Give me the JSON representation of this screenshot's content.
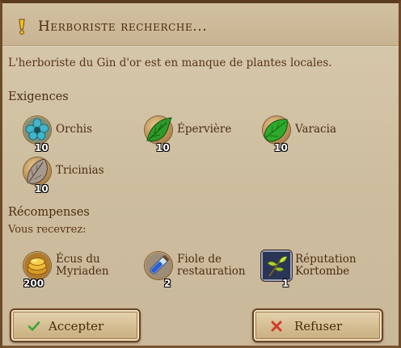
{
  "window": {
    "title": "Herboriste recherche...",
    "title_icon": "exclamation-icon",
    "description": "L'herboriste du Gin d'or est en manque de plantes locales."
  },
  "requirements": {
    "heading": "Exigences",
    "items": [
      {
        "name": "Orchis",
        "quantity": "10",
        "icon": "orchis-flower-icon"
      },
      {
        "name": "Épervière",
        "quantity": "10",
        "icon": "epervière-leaf-icon"
      },
      {
        "name": "Varacia",
        "quantity": "10",
        "icon": "varacia-leaf-icon"
      },
      {
        "name": "Tricinias",
        "quantity": "10",
        "icon": "tricinias-leaf-icon"
      }
    ]
  },
  "rewards": {
    "heading": "Récompenses",
    "subheading": "Vous recevrez:",
    "items": [
      {
        "line1": "Écus du",
        "line2": "Myriaden",
        "quantity": "200",
        "icon": "coin-pile-icon"
      },
      {
        "line1": "Fiole de",
        "line2": "restauration",
        "quantity": "2",
        "icon": "potion-vial-icon"
      },
      {
        "line1": "Réputation",
        "line2": "Kortombe",
        "quantity": "1",
        "icon": "reputation-plant-icon"
      }
    ]
  },
  "buttons": {
    "accept": {
      "label": "Accepter",
      "icon": "checkmark-icon",
      "icon_color": "#3aa832"
    },
    "refuse": {
      "label": "Refuser",
      "icon": "cross-icon",
      "icon_color": "#d23a2a"
    }
  },
  "colors": {
    "panel_background": "#cdbd9e",
    "text_brown": "#5a3416",
    "frame_dark": "#5a3b1f"
  }
}
